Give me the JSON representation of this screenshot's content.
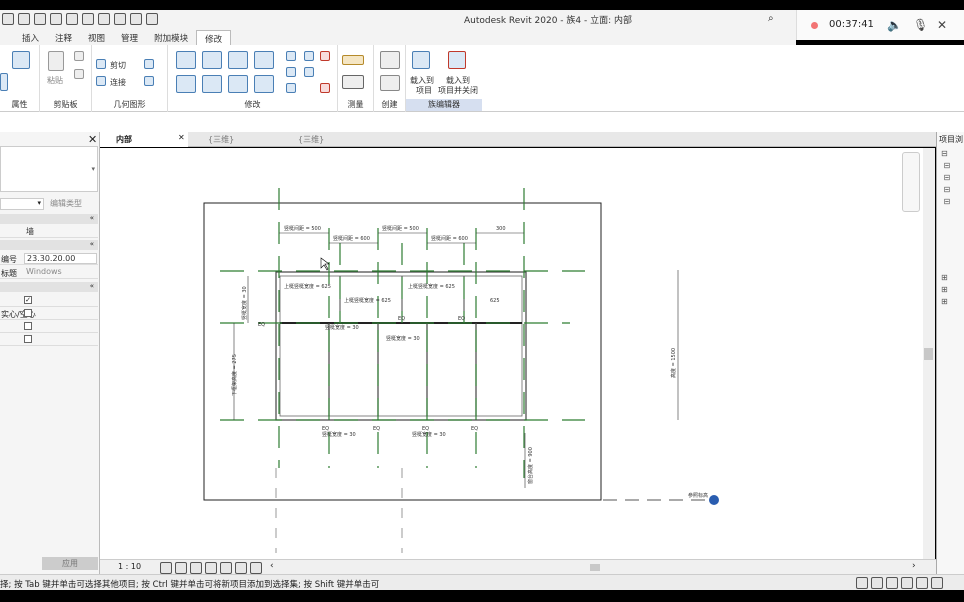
{
  "window": {
    "title": "Autodesk Revit 2020 - 族4 - 立面: 内部"
  },
  "recording": {
    "time": "00:37:41"
  },
  "ribbon": {
    "tabs": [
      "插入",
      "注释",
      "视图",
      "管理",
      "附加模块",
      "修改"
    ],
    "active_tab": "修改",
    "groups": {
      "properties": "属性",
      "clipboard": "剪贴板",
      "geometry": "几何图形",
      "modify": "修改",
      "measure": "测量",
      "create": "创建",
      "family_editor": "族编辑器"
    },
    "buttons": {
      "paste": "粘贴",
      "cut": "剪切",
      "join": "连接",
      "load_into_project_1": "载入到",
      "load_into_project_2": "项目",
      "load_close_1": "载入到",
      "load_close_2": "项目并关闭"
    }
  },
  "properties": {
    "edit_type": "编辑类型",
    "rows": [
      {
        "key": "",
        "value": "墙"
      },
      {
        "key": "编号",
        "value": "23.30.20.00"
      },
      {
        "key": "标题",
        "value": "Windows"
      }
    ],
    "checkbox_label": "实心/空心",
    "apply": "应用"
  },
  "view_tabs": [
    "内部",
    "{三维}",
    "{三维}"
  ],
  "view_bar": {
    "scale": "1 : 10"
  },
  "browser": {
    "title": "项目浏"
  },
  "status": {
    "text": "择; 按 Tab 键并单击可选择其他项目; 按 Ctrl 键并单击可将新项目添加到选择集; 按 Shift 键并单击可"
  },
  "drawing": {
    "dims_top": [
      "竖梃间距 = 500",
      "竖梃间距 = 500",
      "300"
    ],
    "dims_second": [
      "竖梃间距 = 600",
      "竖梃间距 = 600"
    ],
    "row_labels": [
      "上梃竖梃宽度 = 625",
      "上梃竖梃宽度 = 625",
      "625"
    ],
    "mid_label": "上梃竖梃宽度 = 625",
    "eq": "EQ",
    "mullion_labels": [
      "竖梃宽度 = 30",
      "竖梃宽度 = 30",
      "竖梃宽度 = 30",
      "竖梃宽度 = 30"
    ],
    "height": "高度 = 1500",
    "left_side": "下框架高度 = 275",
    "left_side2": "竖梃宽度 = 30",
    "right_bottom": "窗台高度 = 900",
    "ref_level": "参照标高"
  },
  "colors": {
    "accent": "#2e7d32",
    "ribbon_blue": "#4a7fb5",
    "family_editor": "#d6dff0"
  }
}
